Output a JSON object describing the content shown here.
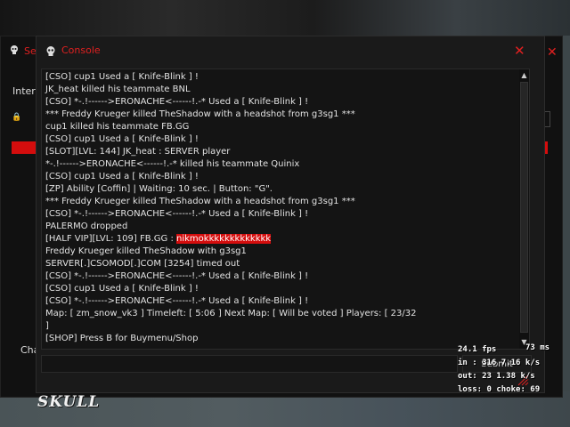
{
  "back_window": {
    "title": "Se",
    "tab_label": "Intern",
    "bottom_label": "Cha"
  },
  "console": {
    "title": "Console",
    "close_label": "✕",
    "lines": [
      {
        "text": "[CSO] cup1 Used a [ Knife-Blink ] !"
      },
      {
        "text": "JK_heat killed his teammate BNL"
      },
      {
        "text": "[CSO] *-.!------>ERONACHE<------!.-* Used a [ Knife-Blink ] !"
      },
      {
        "text": "*** Freddy Krueger killed TheShadow with a headshot from g3sg1 ***"
      },
      {
        "text": "cup1 killed his teammate FB.GG"
      },
      {
        "text": "[CSO] cup1 Used a [ Knife-Blink ] !"
      },
      {
        "text": "[SLOT][LVL: 144] JK_heat : SERVER player"
      },
      {
        "text": "*-.!------>ERONACHE<------!.-* killed his teammate Quinix"
      },
      {
        "text": "[CSO] cup1 Used a [ Knife-Blink ] !"
      },
      {
        "text": "[ZP] Ability [Coffin] | Waiting: 10 sec. | Button: \"G\"."
      },
      {
        "text": "*** Freddy Krueger killed TheShadow with a headshot from g3sg1 ***"
      },
      {
        "text": "[CSO] *-.!------>ERONACHE<------!.-* Used a [ Knife-Blink ] !"
      },
      {
        "text": "PALERMO dropped"
      },
      {
        "text": "[HALF VIP][LVL: 109] FB.GG : ",
        "highlight": "nikmokkkkkkkkkkkkk"
      },
      {
        "text": "Freddy Krueger killed TheShadow with g3sg1"
      },
      {
        "text": "SERVER[.]CSOMOD[.]COM [3254] timed out"
      },
      {
        "text": "[CSO] *-.!------>ERONACHE<------!.-* Used a [ Knife-Blink ] !"
      },
      {
        "text": "[CSO] cup1 Used a [ Knife-Blink ] !"
      },
      {
        "text": "[CSO] *-.!------>ERONACHE<------!.-* Used a [ Knife-Blink ] !"
      },
      {
        "text": "Map: [ zm_snow_vk3 ] Timeleft: [ 5:06 ] Next Map: [ Will be voted ] Players: [ 23/32"
      },
      {
        "text": "]"
      },
      {
        "text": "[SHOP] Press B for Buymenu/Shop"
      }
    ],
    "input_value": "",
    "submit_label": "Submit"
  },
  "logo": {
    "text": "SKULL"
  },
  "netgraph": {
    "fps": "24.1 fps",
    "ms": "73 ms",
    "in": "in :  316 7.16 k/s",
    "out": "out: 23 1.38 k/s",
    "loss": "loss: 0 choke:  69"
  },
  "colors": {
    "accent": "#e02020",
    "highlight": "#d40d0d"
  }
}
